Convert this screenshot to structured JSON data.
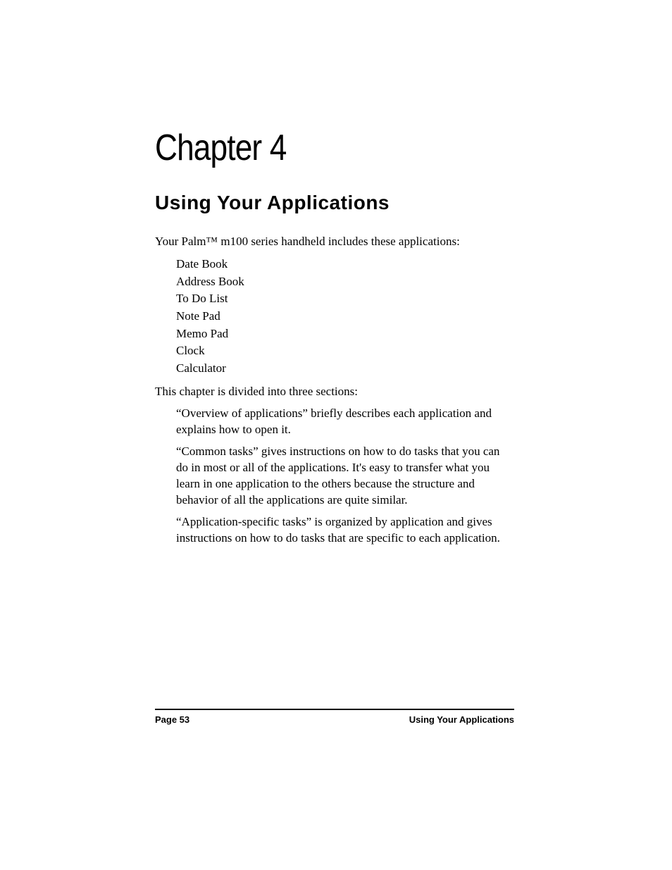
{
  "chapter_title": "Chapter 4",
  "section_title": "Using Your Applications",
  "intro": "Your Palm™ m100 series handheld includes these applications:",
  "applications": [
    "Date Book",
    "Address Book",
    "To Do List",
    "Note Pad",
    "Memo Pad",
    "Clock",
    "Calculator"
  ],
  "divider": "This chapter is divided into three sections:",
  "sections": [
    "“Overview of applications” briefly describes each application and explains how to open it.",
    "“Common tasks” gives instructions on how to do tasks that you can do in most or all of the applications. It's easy to transfer what you learn in one application to the others because the structure and behavior of all the applications are quite similar.",
    "“Application-specific tasks” is organized by application and gives instructions on how to do tasks that are specific to each application."
  ],
  "footer": {
    "page_label": "Page 53",
    "section_label": "Using Your Applications"
  }
}
